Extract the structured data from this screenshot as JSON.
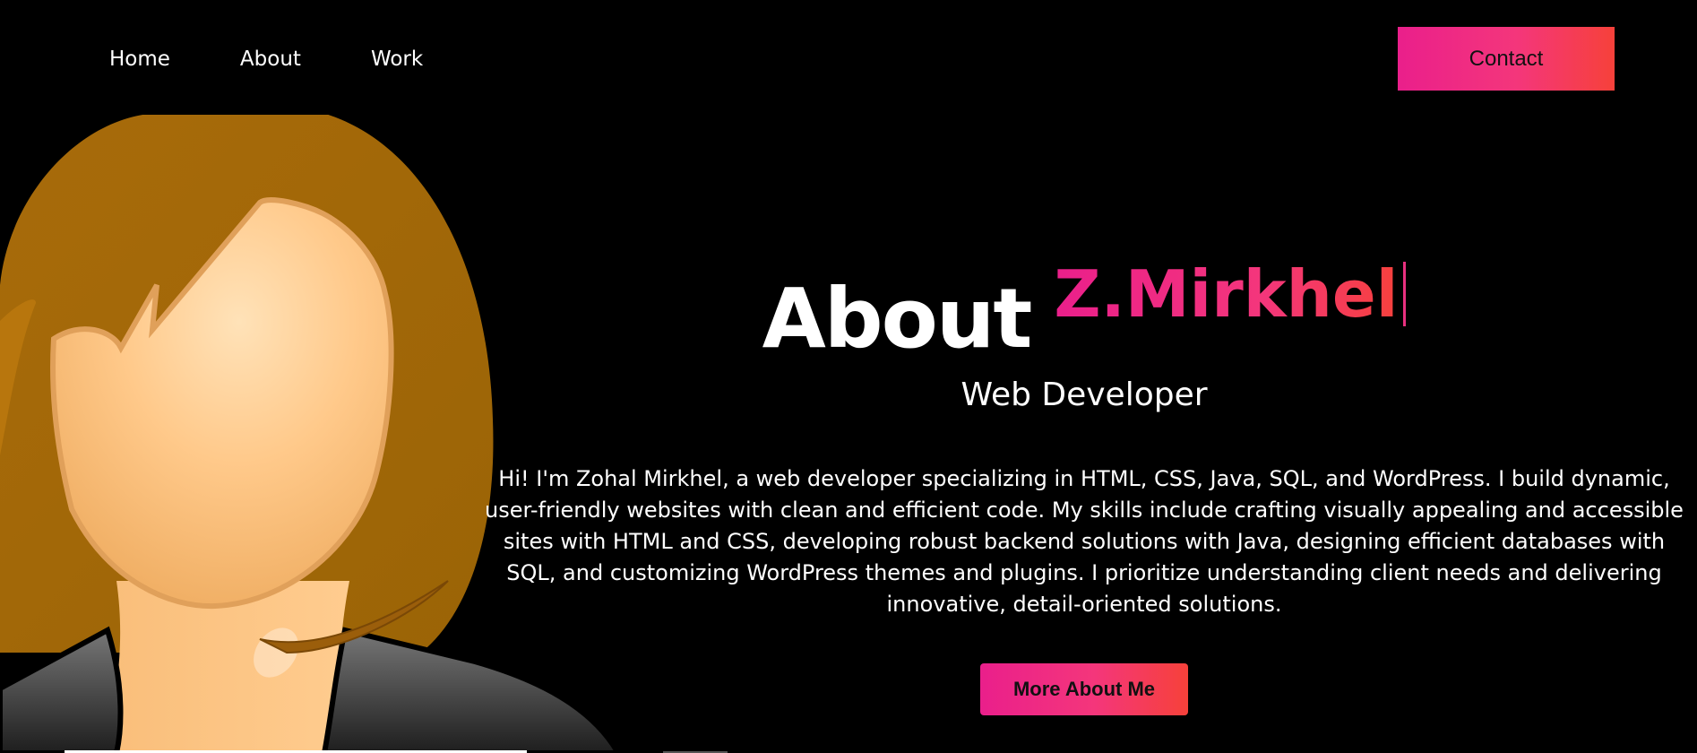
{
  "nav": {
    "items": [
      {
        "label": "Home"
      },
      {
        "label": "About"
      },
      {
        "label": "Work"
      }
    ],
    "contact_label": "Contact"
  },
  "hero": {
    "title_prefix": "About",
    "title_name": "Z.Mirkhel",
    "subtitle": "Web Developer",
    "bio": "Hi! I'm Zohal Mirkhel, a web developer specializing in HTML, CSS, Java, SQL, and WordPress. I build dynamic, user-friendly websites with clean and efficient code. My skills include crafting visually appealing and accessible sites with HTML and CSS, developing robust backend solutions with Java, designing efficient databases with SQL, and customizing WordPress themes and plugins. I prioritize understanding client needs and delivering innovative, detail-oriented solutions.",
    "cta_label": "More About Me"
  },
  "colors": {
    "background": "#000000",
    "accent_start": "#ea1f8b",
    "accent_end": "#f6413a",
    "text": "#ffffff"
  },
  "icons": {
    "avatar": "woman-avatar-illustration"
  }
}
